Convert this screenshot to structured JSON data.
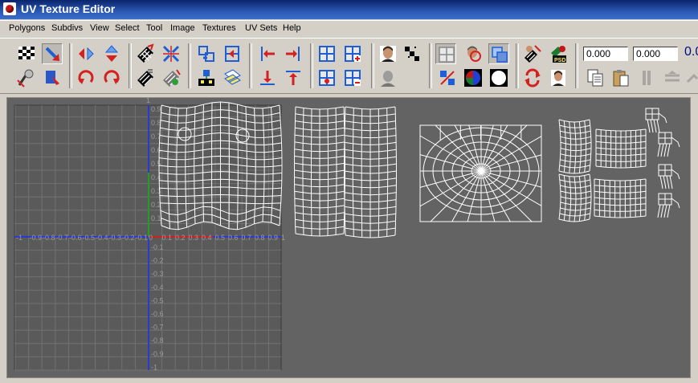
{
  "window": {
    "title": "UV Texture Editor"
  },
  "menu": [
    "Polygons",
    "Subdivs",
    "View",
    "Select",
    "Tool",
    "Image",
    "Textures",
    "UV Sets",
    "Help"
  ],
  "toolbar": {
    "field_u": "0.000",
    "field_v": "0.000",
    "field_extra": "0.0"
  },
  "grid": {
    "top_tick": "1",
    "h_labels": [
      "-1",
      "-0.9",
      "-0.8",
      "-0.7",
      "-0.6",
      "-0.5",
      "-0.4",
      "-0.3",
      "-0.2",
      "-0.1",
      "0",
      "0.1",
      "0.2",
      "0.3",
      "0.4",
      "0.5",
      "0.6",
      "0.7",
      "0.8",
      "0.9",
      "1"
    ],
    "v_labels_pos": [
      "0.9",
      "0.8",
      "0.7",
      "0.6",
      "0.5",
      "0.4",
      "0.3",
      "0.2",
      "0.1"
    ],
    "v_labels_neg": [
      "-0.1",
      "-0.2",
      "-0.3",
      "-0.4",
      "-0.5",
      "-0.6",
      "-0.7",
      "-0.8",
      "-0.9",
      "-1"
    ]
  }
}
